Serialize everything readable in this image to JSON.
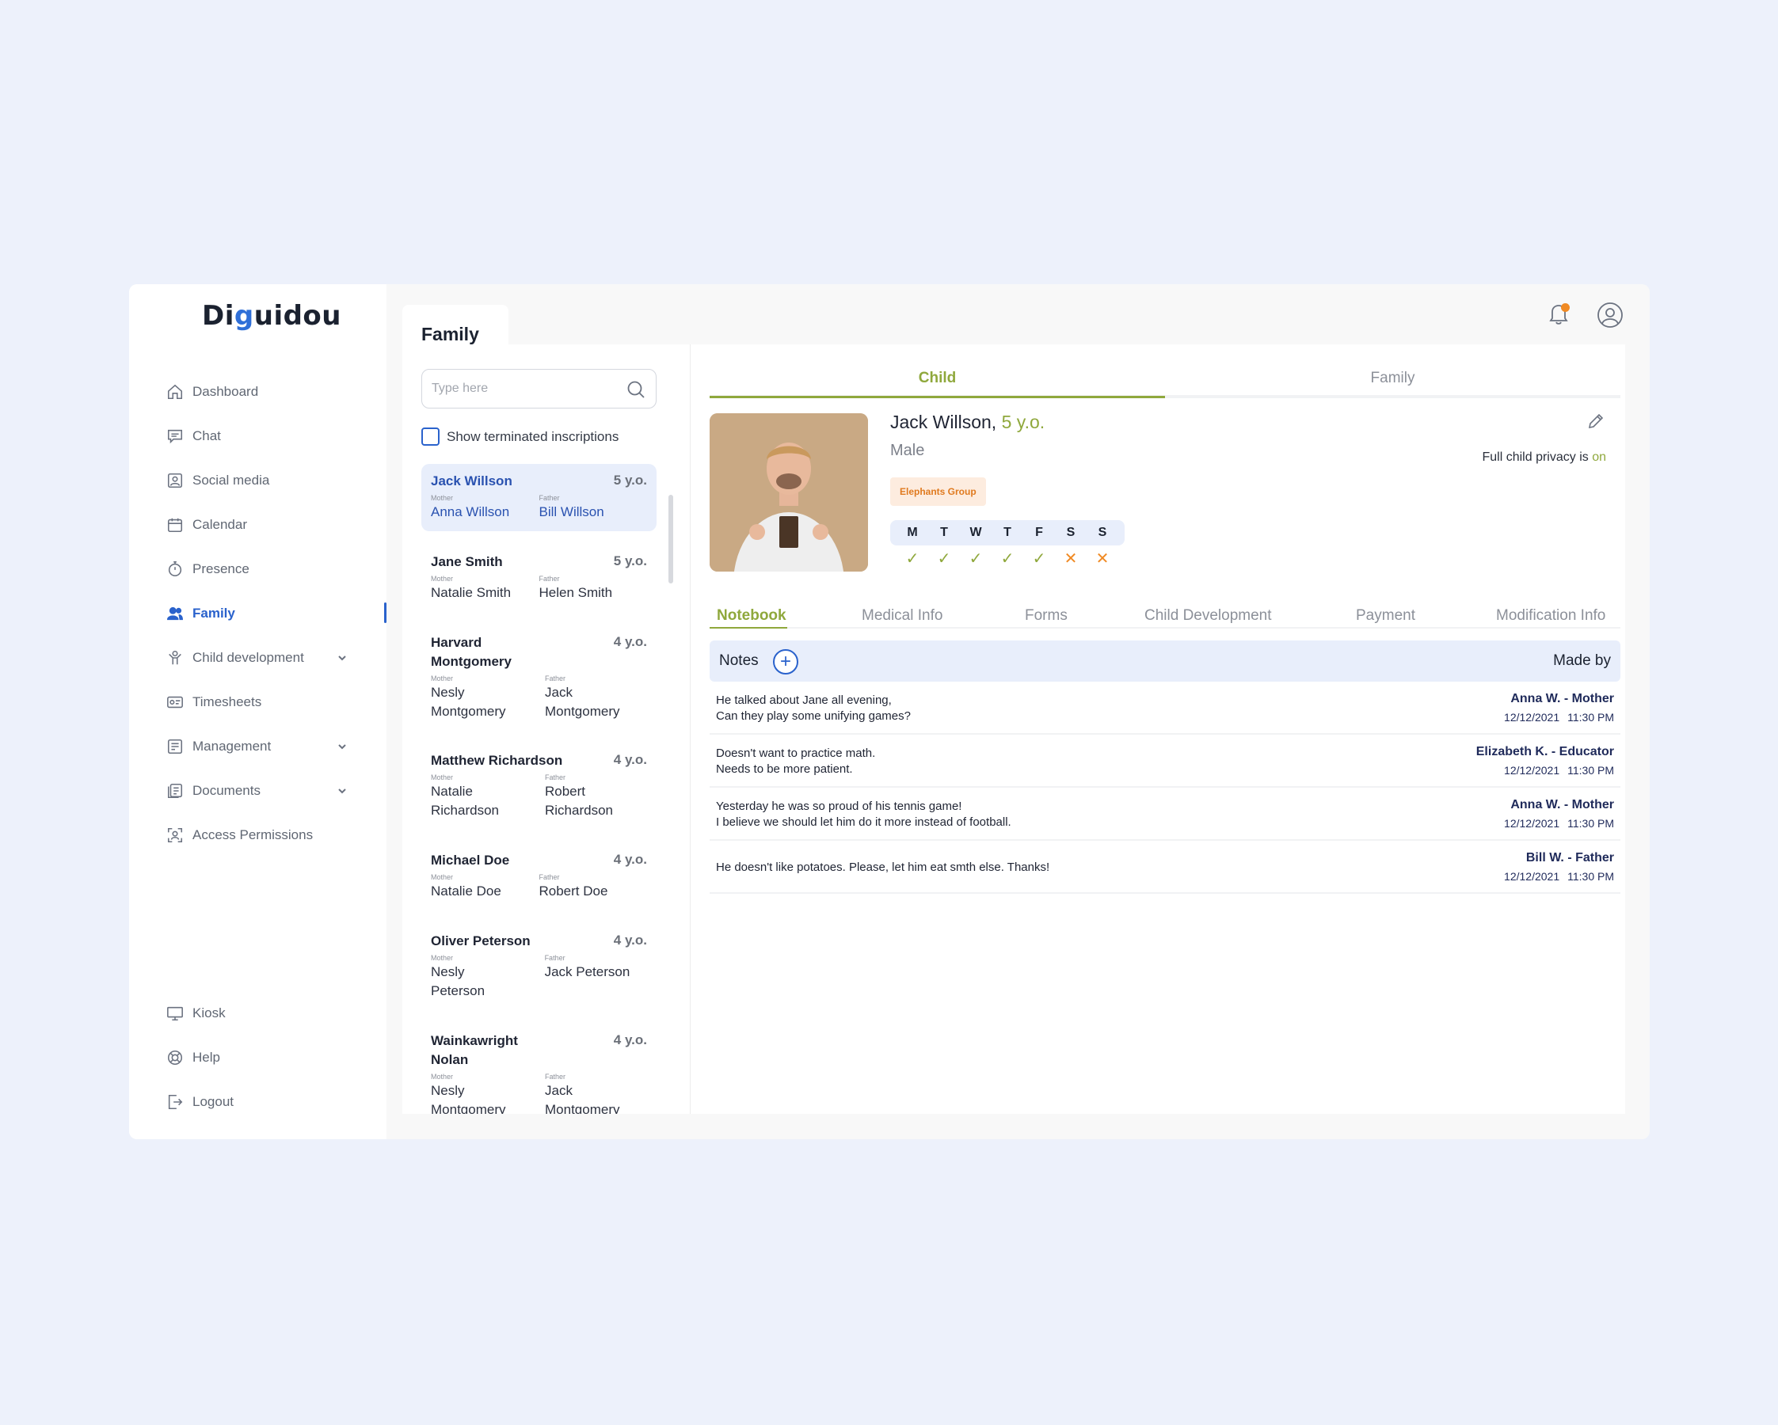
{
  "logo": {
    "prefix": "Di",
    "mark": "g",
    "suffix": "uidou"
  },
  "sidebar": {
    "items": [
      {
        "label": "Dashboard",
        "icon": "home-icon"
      },
      {
        "label": "Chat",
        "icon": "chat-icon"
      },
      {
        "label": "Social media",
        "icon": "social-media-icon"
      },
      {
        "label": "Calendar",
        "icon": "calendar-icon"
      },
      {
        "label": "Presence",
        "icon": "stopwatch-icon"
      },
      {
        "label": "Family",
        "icon": "people-icon",
        "active": true
      },
      {
        "label": "Child development",
        "icon": "child-icon",
        "expandable": true
      },
      {
        "label": "Timesheets",
        "icon": "timesheet-icon"
      },
      {
        "label": "Management",
        "icon": "management-icon",
        "expandable": true
      },
      {
        "label": "Documents",
        "icon": "documents-icon",
        "expandable": true
      },
      {
        "label": "Access Permissions",
        "icon": "access-icon"
      }
    ],
    "bottom": [
      {
        "label": "Kiosk",
        "icon": "monitor-icon"
      },
      {
        "label": "Help",
        "icon": "help-icon"
      },
      {
        "label": "Logout",
        "icon": "logout-icon"
      }
    ]
  },
  "header": {
    "page_title": "Family"
  },
  "search": {
    "placeholder": "Type here"
  },
  "filter": {
    "terminated_label": "Show terminated inscriptions",
    "checked": false
  },
  "parent_labels": {
    "mother": "Mother",
    "father": "Father"
  },
  "children": [
    {
      "name": "Jack Willson",
      "age": "5 y.o.",
      "mother": "Anna Willson",
      "father": "Bill Willson",
      "selected": true
    },
    {
      "name": "Jane Smith",
      "age": "5 y.o.",
      "mother": "Natalie Smith",
      "father": "Helen Smith"
    },
    {
      "name": "Harvard Montgomery",
      "age": "4 y.o.",
      "mother": "Nesly Montgomery",
      "father": "Jack Montgomery"
    },
    {
      "name": "Matthew Richardson",
      "age": "4 y.o.",
      "mother": "Natalie Richardson",
      "father": "Robert Richardson"
    },
    {
      "name": "Michael Doe",
      "age": "4 y.o.",
      "mother": "Natalie Doe",
      "father": "Robert Doe"
    },
    {
      "name": "Oliver Peterson",
      "age": "4 y.o.",
      "mother": "Nesly Peterson",
      "father": "Jack Peterson"
    },
    {
      "name": "Wainkawright Nolan",
      "age": "4 y.o.",
      "mother": "Nesly Montgomery",
      "father": "Jack Montgomery"
    }
  ],
  "detail": {
    "tabs": [
      "Child",
      "Family"
    ],
    "active_tab": "Child",
    "child": {
      "name": "Jack Willson,",
      "age": "5 y.o.",
      "gender": "Male",
      "group": "Elephants Group",
      "privacy_prefix": "Full child privacy is",
      "privacy_value": "on"
    },
    "week": {
      "days": [
        "M",
        "T",
        "W",
        "T",
        "F",
        "S",
        "S"
      ],
      "present": [
        true,
        true,
        true,
        true,
        true,
        false,
        false
      ]
    },
    "sub_tabs": [
      "Notebook",
      "Medical Info",
      "Forms",
      "Child Development",
      "Payment",
      "Modification Info"
    ],
    "active_sub_tab": "Notebook",
    "notes_header": {
      "title": "Notes",
      "add_symbol": "+",
      "made_by": "Made by"
    },
    "notes": [
      {
        "lines": [
          "He talked about Jane all evening,",
          "Can they play some unifying games?"
        ],
        "author": "Anna W. - Mother",
        "date": "12/12/2021",
        "time": "11:30 PM"
      },
      {
        "lines": [
          "Doesn't want to practice math.",
          "Needs to be more patient."
        ],
        "author": "Elizabeth K. - Educator",
        "date": "12/12/2021",
        "time": "11:30 PM"
      },
      {
        "lines": [
          "Yesterday he was so proud of his tennis game!",
          "I believe we should let him do it more instead of football."
        ],
        "author": "Anna W. - Mother",
        "date": "12/12/2021",
        "time": "11:30 PM"
      },
      {
        "lines": [
          "He doesn't like potatoes. Please, let him eat smth else. Thanks!"
        ],
        "author": "Bill W. - Father",
        "date": "12/12/2021",
        "time": "11:30 PM"
      }
    ]
  },
  "colors": {
    "accent_blue": "#2a62cc",
    "accent_green": "#8fa83c",
    "accent_orange": "#f08a24",
    "background": "#edf1fb"
  }
}
